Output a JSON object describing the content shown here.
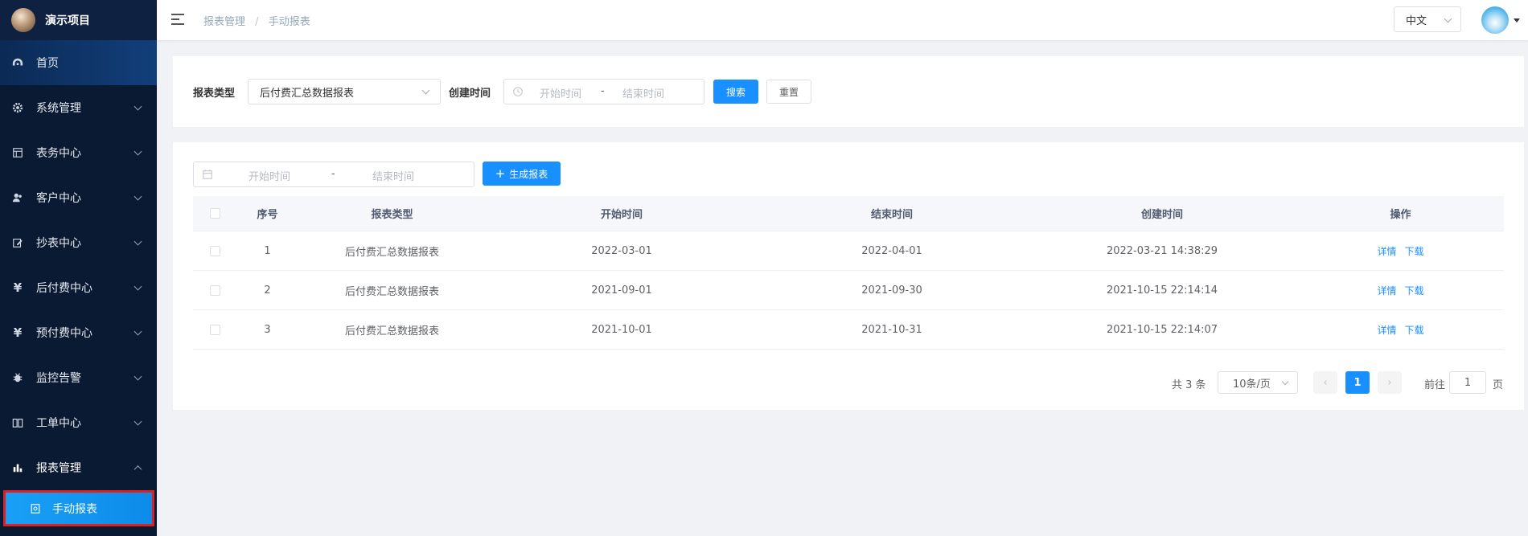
{
  "app": {
    "title": "演示项目"
  },
  "sidebar": {
    "items": [
      {
        "label": "首页",
        "icon": "dashboard-icon"
      },
      {
        "label": "系统管理",
        "icon": "gear-icon"
      },
      {
        "label": "表务中心",
        "icon": "grid-icon"
      },
      {
        "label": "客户中心",
        "icon": "users-icon"
      },
      {
        "label": "抄表中心",
        "icon": "edit-icon"
      },
      {
        "label": "后付费中心",
        "icon": "yen-icon"
      },
      {
        "label": "预付费中心",
        "icon": "yen-icon"
      },
      {
        "label": "监控告警",
        "icon": "bug-icon"
      },
      {
        "label": "工单中心",
        "icon": "book-icon"
      },
      {
        "label": "报表管理",
        "icon": "bar-chart-icon"
      }
    ],
    "active_sub": {
      "label": "手动报表",
      "icon": "report-icon"
    }
  },
  "header": {
    "breadcrumb": [
      "报表管理",
      "手动报表"
    ],
    "breadcrumb_sep": "/",
    "language": "中文"
  },
  "filter": {
    "report_type_label": "报表类型",
    "report_type_value": "后付费汇总数据报表",
    "create_time_label": "创建时间",
    "start_placeholder": "开始时间",
    "end_placeholder": "结束时间",
    "range_sep": "-",
    "search_label": "搜索",
    "reset_label": "重置"
  },
  "toolbar": {
    "start_placeholder": "开始时间",
    "end_placeholder": "结束时间",
    "range_sep": "-",
    "generate_label": "生成报表"
  },
  "table": {
    "columns": [
      "序号",
      "报表类型",
      "开始时间",
      "结束时间",
      "创建时间",
      "操作"
    ],
    "rows": [
      {
        "index": "1",
        "type": "后付费汇总数据报表",
        "start": "2022-03-01",
        "end": "2022-04-01",
        "created": "2022-03-21 14:38:29"
      },
      {
        "index": "2",
        "type": "后付费汇总数据报表",
        "start": "2021-09-01",
        "end": "2021-09-30",
        "created": "2021-10-15 22:14:14"
      },
      {
        "index": "3",
        "type": "后付费汇总数据报表",
        "start": "2021-10-01",
        "end": "2021-10-31",
        "created": "2021-10-15 22:14:07"
      }
    ],
    "actions": {
      "detail": "详情",
      "download": "下载"
    }
  },
  "pagination": {
    "total": "共 3 条",
    "page_size": "10条/页",
    "current_page": "1",
    "goto_label": "前往",
    "goto_value": "1",
    "page_word": "页"
  },
  "colors": {
    "primary": "#1890ff",
    "sidebar_bg": "#0b1a33",
    "highlight_border": "#e02020"
  }
}
